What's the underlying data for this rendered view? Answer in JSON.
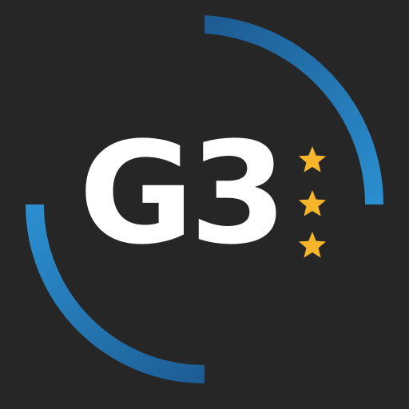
{
  "logo": {
    "text": "G3",
    "text_color": "#FFFFFF",
    "background_color": "#262626",
    "ring_color_light": "#2B8FD0",
    "ring_color_dark": "#1D5B92",
    "star_color": "#F7B52C",
    "star_count": 3,
    "ring_icon": "partial-ring-arcs",
    "star_icon": "star-icon"
  }
}
